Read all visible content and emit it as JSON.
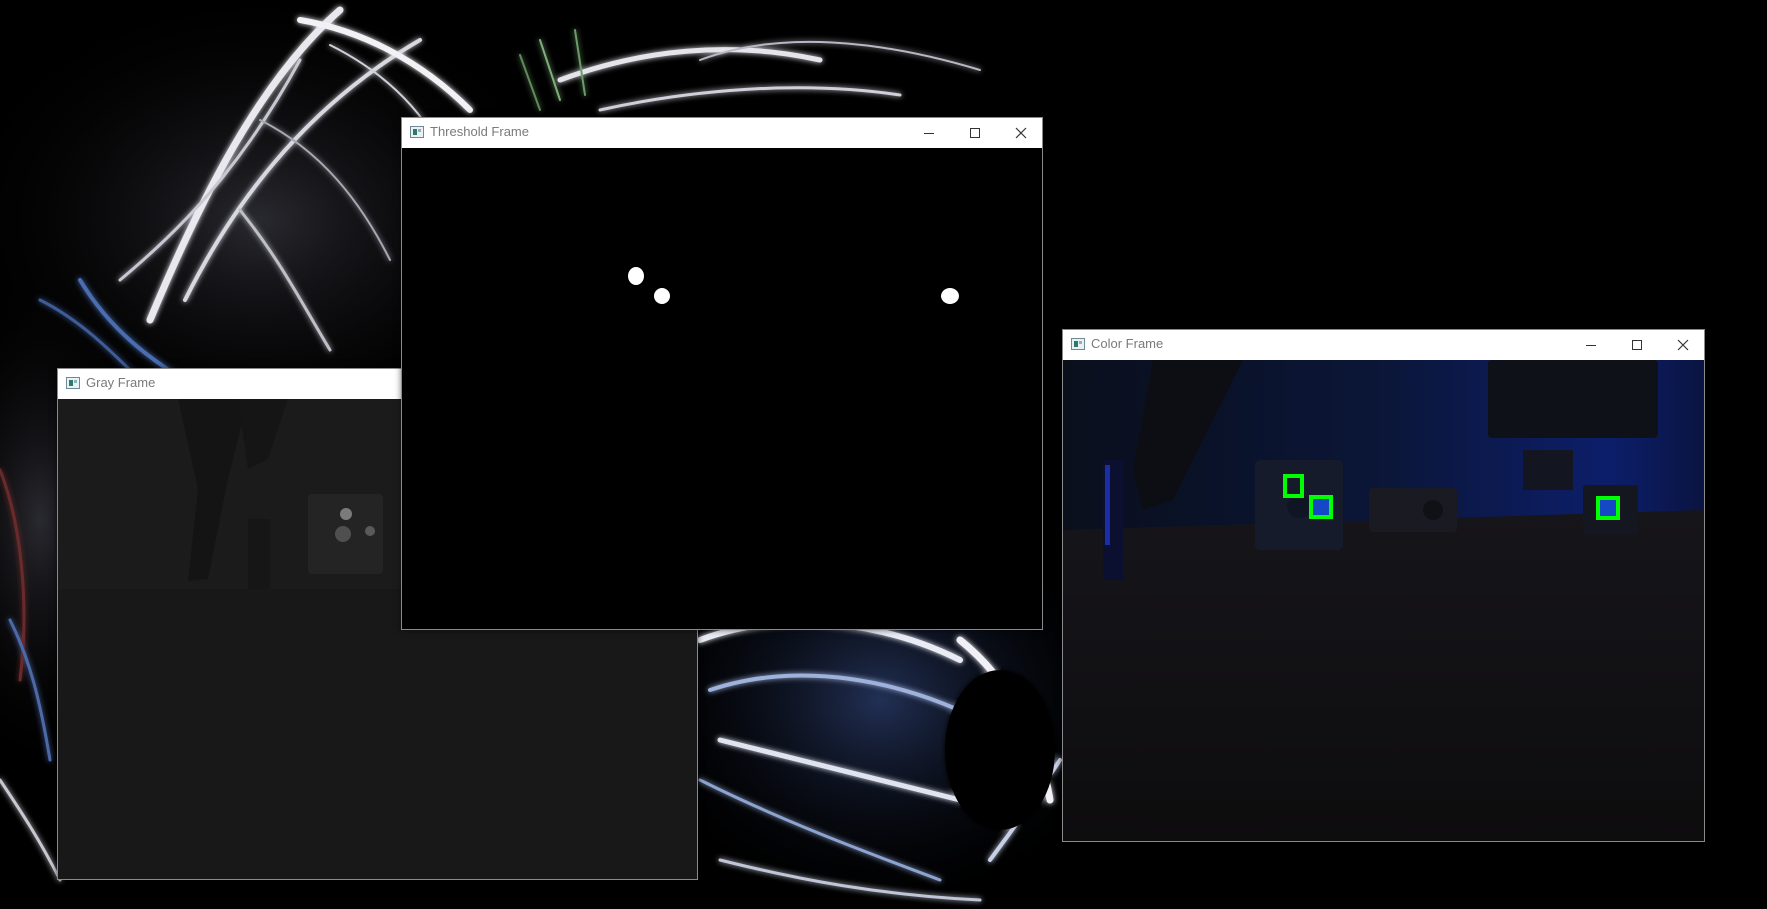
{
  "windows": {
    "threshold": {
      "title": "Threshold Frame",
      "blobs": 3
    },
    "gray": {
      "title": "Gray Frame"
    },
    "color": {
      "title": "Color Frame",
      "detections": 3,
      "detection_color": "#00ff00"
    }
  },
  "icons": {
    "minimize": "minimize-icon",
    "maximize": "maximize-icon",
    "close": "close-icon",
    "app": "opencv-window-icon"
  }
}
